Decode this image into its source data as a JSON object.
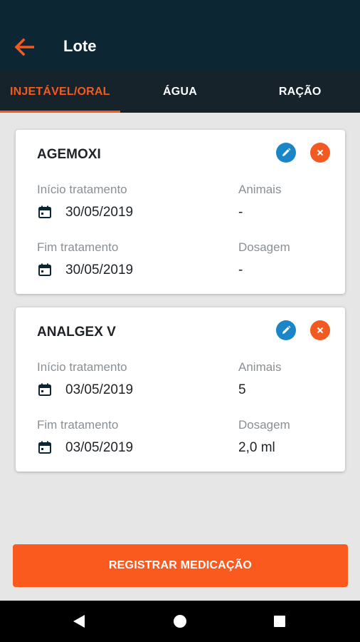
{
  "app_bar": {
    "title": "Lote",
    "back_icon": "arrow-left-icon",
    "accent_color": "#f25a22",
    "background_color": "#0d2633"
  },
  "tabs": [
    {
      "label": "INJETÁVEL/ORAL",
      "active": true
    },
    {
      "label": "ÁGUA",
      "active": false
    },
    {
      "label": "RAÇÃO",
      "active": false
    }
  ],
  "medications": [
    {
      "name": "AGEMOXI",
      "start_label": "Início tratamento",
      "start_date": "30/05/2019",
      "end_label": "Fim tratamento",
      "end_date": "30/05/2019",
      "animals_label": "Animais",
      "animals_value": "-",
      "dosage_label": "Dosagem",
      "dosage_value": "-"
    },
    {
      "name": "ANALGEX V",
      "start_label": "Início tratamento",
      "start_date": "03/05/2019",
      "end_label": "Fim tratamento",
      "end_date": "03/05/2019",
      "animals_label": "Animais",
      "animals_value": "5",
      "dosage_label": "Dosagem",
      "dosage_value": "2,0 ml"
    }
  ],
  "footer": {
    "register_label": "REGISTRAR MEDICAÇÃO",
    "button_color": "#fb5a1e"
  },
  "system_nav": {
    "icons": [
      "nav-back-icon",
      "nav-home-icon",
      "nav-recents-icon"
    ]
  }
}
